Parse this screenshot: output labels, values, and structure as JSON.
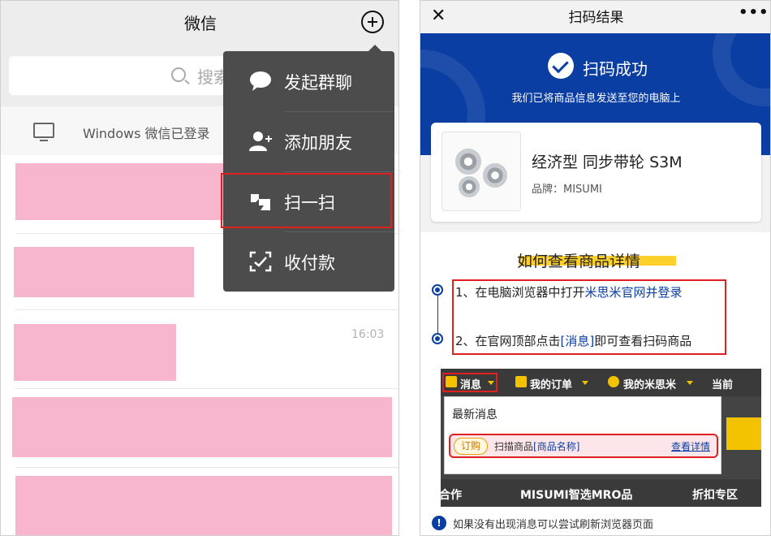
{
  "left": {
    "title": "微信",
    "search_placeholder": "搜索",
    "windows_login_text": "Windows 微信已登录",
    "chat_time": "16:03",
    "menu": {
      "items": [
        {
          "label": "发起群聊",
          "icon": "chat-bubble-icon"
        },
        {
          "label": "添加朋友",
          "icon": "add-friend-icon"
        },
        {
          "label": "扫一扫",
          "icon": "scan-icon"
        },
        {
          "label": "收付款",
          "icon": "payment-icon"
        }
      ]
    }
  },
  "right": {
    "title": "扫码结果",
    "close_icon": "close-icon",
    "more_icon": "more-icon",
    "success_text": "扫码成功",
    "success_sub": "我们已将商品信息发送至您的电脑上",
    "product": {
      "name": "经济型 同步带轮 S3M",
      "brand": "品牌：MISUMI"
    },
    "howto_title": "如何查看商品详情",
    "step1_prefix": "1、在电脑浏览器中打开",
    "step1_link": "米思米官网并登录",
    "step2_prefix": "2、在官网顶部点击",
    "step2_link": "[消息]",
    "step2_suffix": "即可查看扫码商品",
    "illustration": {
      "nav_messages": "消息",
      "nav_orders": "我的订单",
      "nav_my": "我的米思米",
      "nav_current": "当前",
      "latest": "最新消息",
      "order_tag": "订购",
      "scan_item_prefix": "扫描商品",
      "scan_item_link": "[商品名称]",
      "view_detail": "查看详情",
      "bottom_left": "合作",
      "bottom_mid": "MISUMI智选MRO品",
      "bottom_right": "折扣专区"
    },
    "notice": "如果没有出现消息可以尝试刷新浏览器页面"
  },
  "colors": {
    "brand_blue": "#0b3ea3",
    "highlight_yellow": "#ffd02b",
    "annotation_red": "#e02020",
    "redaction_pink": "#f8b5ce",
    "menu_bg": "#4c4c4c"
  }
}
